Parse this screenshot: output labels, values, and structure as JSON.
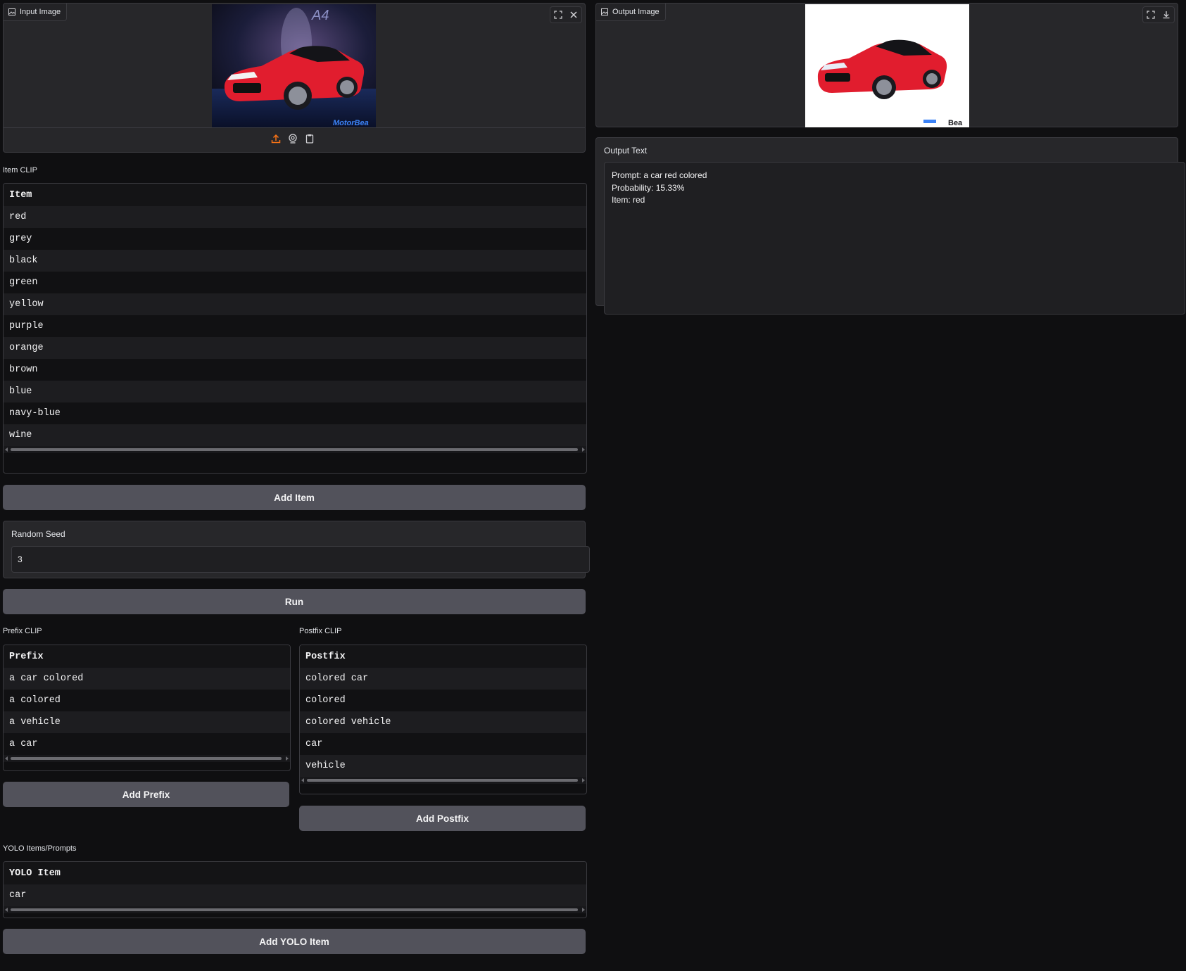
{
  "input_image": {
    "badge_label": "Input Image",
    "photo_model_text": "A4",
    "photo_watermark": "MotorBea",
    "source_icons": [
      "upload-icon",
      "webcam-icon",
      "clipboard-icon"
    ]
  },
  "output_image": {
    "badge_label": "Output Image",
    "watermark": "Bea"
  },
  "output_text": {
    "label": "Output Text",
    "lines": [
      "Prompt: a car red colored",
      "Probability: 15.33%",
      "Item: red"
    ]
  },
  "item_clip": {
    "label": "Item CLIP",
    "header": "Item",
    "rows": [
      "red",
      "grey",
      "black",
      "green",
      "yellow",
      "purple",
      "orange",
      "brown",
      "blue",
      "navy-blue",
      "wine"
    ],
    "add_button": "Add Item"
  },
  "random_seed": {
    "label": "Random Seed",
    "value": "3"
  },
  "run_button": "Run",
  "prefix_clip": {
    "label": "Prefix CLIP",
    "header": "Prefix",
    "rows": [
      "a car colored",
      "a colored",
      "a vehicle",
      "a car"
    ],
    "add_button": "Add Prefix"
  },
  "postfix_clip": {
    "label": "Postfix CLIP",
    "header": "Postfix",
    "rows": [
      "colored car",
      "colored",
      "colored vehicle",
      "car",
      "vehicle"
    ],
    "add_button": "Add Postfix"
  },
  "yolo": {
    "label": "YOLO Items/Prompts",
    "header": "YOLO Item",
    "rows": [
      "car"
    ],
    "add_button": "Add YOLO Item"
  },
  "colors": {
    "background": "#0f0f11",
    "panel": "#27272a",
    "button": "#52525b",
    "accent_orange": "#f97316",
    "car_red": "#e11d2e"
  }
}
